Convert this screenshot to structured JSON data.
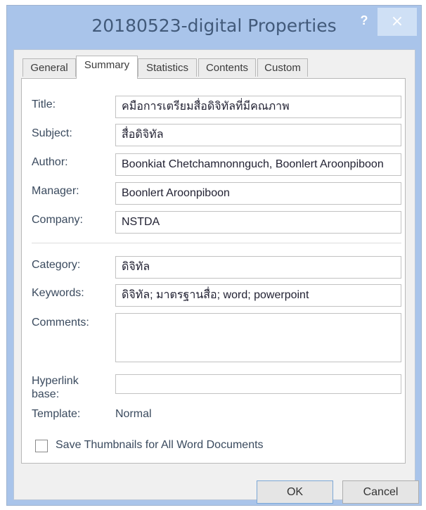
{
  "window": {
    "title": "20180523-digital Properties",
    "help_label": "?",
    "close_label": "×"
  },
  "tabs": [
    {
      "label": "General"
    },
    {
      "label": "Summary",
      "active": true
    },
    {
      "label": "Statistics"
    },
    {
      "label": "Contents"
    },
    {
      "label": "Custom"
    }
  ],
  "fields": {
    "title": {
      "label": "Title:",
      "value": "คมือการเตรียมสื่อดิจิทัลที่มีคณภาพ"
    },
    "subject": {
      "label": "Subject:",
      "value": "สื่อดิจิทัล"
    },
    "author": {
      "label": "Author:",
      "value": "Boonkiat Chetchamnonnguch, Boonlert Aroonpiboon"
    },
    "manager": {
      "label": "Manager:",
      "value": "Boonlert Aroonpiboon"
    },
    "company": {
      "label": "Company:",
      "value": "NSTDA"
    },
    "category": {
      "label": "Category:",
      "value": "ดิจิทัล"
    },
    "keywords": {
      "label": "Keywords:",
      "value": "ดิจิทัล; มาตรฐานสื่อ; word; powerpoint"
    },
    "comments": {
      "label": "Comments:",
      "value": ""
    },
    "hyperlink_base": {
      "label": "Hyperlink base:",
      "value": ""
    },
    "template": {
      "label": "Template:",
      "value": "Normal"
    }
  },
  "checkbox": {
    "label": "Save Thumbnails for All Word Documents",
    "checked": false
  },
  "buttons": {
    "ok_label": "OK",
    "cancel_label": "Cancel"
  }
}
